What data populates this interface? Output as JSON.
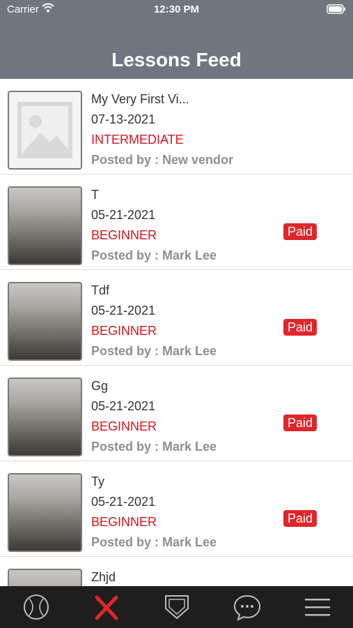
{
  "status": {
    "carrier": "Carrier",
    "time": "12:30 PM"
  },
  "header": {
    "title": "Lessons Feed"
  },
  "lessons": [
    {
      "title": "My Very First Vi...",
      "date": "07-13-2021",
      "level": "INTERMEDIATE",
      "poster": "Posted by : New vendor",
      "badge": "",
      "thumb": "placeholder"
    },
    {
      "title": "T",
      "date": "05-21-2021",
      "level": "BEGINNER",
      "poster": "Posted by : Mark Lee",
      "badge": "Paid",
      "thumb": "video"
    },
    {
      "title": "Tdf",
      "date": "05-21-2021",
      "level": "BEGINNER",
      "poster": "Posted by : Mark Lee",
      "badge": "Paid",
      "thumb": "video"
    },
    {
      "title": "Gg",
      "date": "05-21-2021",
      "level": "BEGINNER",
      "poster": "Posted by : Mark Lee",
      "badge": "Paid",
      "thumb": "video"
    },
    {
      "title": "Ty",
      "date": "05-21-2021",
      "level": "BEGINNER",
      "poster": "Posted by : Mark Lee",
      "badge": "Paid",
      "thumb": "video"
    },
    {
      "title": "Zhjd",
      "date": "",
      "level": "",
      "poster": "",
      "badge": "",
      "thumb": "video"
    }
  ],
  "tabbar": {
    "tabs": [
      {
        "icon": "baseball-icon",
        "active": false
      },
      {
        "icon": "crossed-bats-icon",
        "active": true
      },
      {
        "icon": "home-plate-icon",
        "active": false
      },
      {
        "icon": "chat-bubble-icon",
        "active": false
      },
      {
        "icon": "menu-icon",
        "active": false
      }
    ]
  },
  "colors": {
    "header": "#6f767f",
    "level": "#d8131b",
    "badge": "#e0262b",
    "tabbar": "#1e1e1e",
    "tab_active": "#e0262b"
  }
}
